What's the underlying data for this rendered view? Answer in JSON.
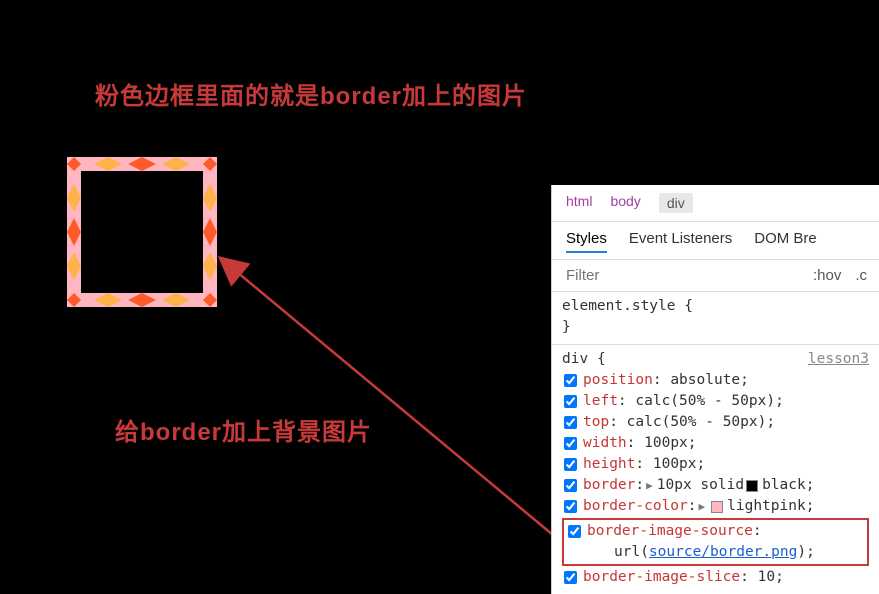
{
  "headline": "粉色边框里面的就是border加上的图片",
  "annotation": "给border加上背景图片",
  "breadcrumb": {
    "items": [
      "html",
      "body",
      "div"
    ],
    "active": 2
  },
  "tabs": {
    "items": [
      "Styles",
      "Event Listeners",
      "DOM Bre"
    ],
    "active": 0
  },
  "filter": {
    "placeholder": "Filter",
    "right1": ":hov",
    "right2": ".c"
  },
  "rules": {
    "element_style": {
      "selector": "element.style",
      "open": "{",
      "close": "}"
    },
    "div_rule": {
      "selector": "div",
      "open": "{",
      "source": "lesson3",
      "decls": [
        {
          "prop": "position",
          "val": "absolute",
          "checked": true
        },
        {
          "prop": "left",
          "val": "calc(50% - 50px)",
          "checked": true
        },
        {
          "prop": "top",
          "val": "calc(50% - 50px)",
          "checked": true
        },
        {
          "prop": "width",
          "val": "100px",
          "checked": true
        },
        {
          "prop": "height",
          "val": "100px",
          "checked": true
        },
        {
          "prop": "border",
          "val": "10px solid",
          "swatch": "black",
          "val2": "black",
          "checked": true,
          "tri": true
        },
        {
          "prop": "border-color",
          "swatch": "lightpink",
          "val2": "lightpink",
          "checked": true,
          "tri": true
        },
        {
          "prop": "border-image-source",
          "val_pre": "url(",
          "val_link": "source/border.png",
          "val_post": ")",
          "checked": true,
          "highlight": true
        },
        {
          "prop": "border-image-slice",
          "val": "10",
          "checked": true
        }
      ]
    }
  }
}
